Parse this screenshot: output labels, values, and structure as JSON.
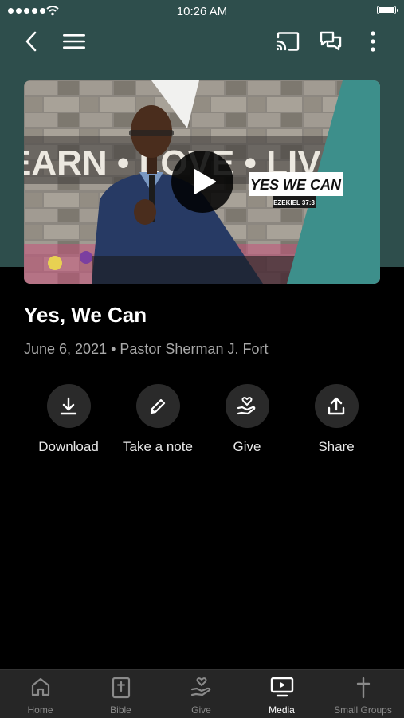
{
  "status_bar": {
    "time": "10:26 AM"
  },
  "nav": {
    "back_icon": "chevron-left-icon",
    "menu_icon": "hamburger-menu-icon",
    "cast_icon": "cast-icon",
    "chat_icon": "chat-bubbles-icon",
    "more_icon": "more-vertical-icon"
  },
  "video": {
    "banner_text": "YES WE CAN",
    "scripture": "EZEKIEL 37:3",
    "backdrop_text": "EARN • LOVE • LIVE"
  },
  "sermon": {
    "title": "Yes, We Can",
    "meta": "June 6, 2021 • Pastor Sherman J. Fort"
  },
  "actions": [
    {
      "label": "Download",
      "icon": "download-icon"
    },
    {
      "label": "Take a note",
      "icon": "pencil-icon"
    },
    {
      "label": "Give",
      "icon": "hand-heart-icon"
    },
    {
      "label": "Share",
      "icon": "share-icon"
    }
  ],
  "tabs": [
    {
      "label": "Home",
      "icon": "home-icon"
    },
    {
      "label": "Bible",
      "icon": "bible-icon"
    },
    {
      "label": "Give",
      "icon": "give-icon"
    },
    {
      "label": "Media",
      "icon": "media-icon",
      "active": true
    },
    {
      "label": "Small Groups",
      "icon": "cross-icon"
    }
  ],
  "colors": {
    "header_bg": "#2e4e4c",
    "accent_teal": "#3d8f8b",
    "background": "#000000"
  }
}
